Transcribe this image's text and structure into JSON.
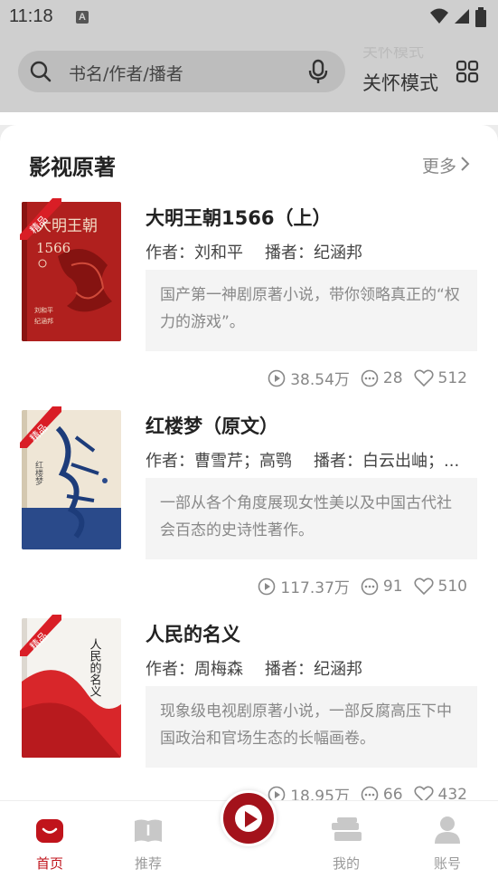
{
  "status_bar": {
    "time": "11:18",
    "a_label": "A"
  },
  "header": {
    "search_placeholder": "书名/作者/播者",
    "care_mode_ghost": "关怀模式",
    "care_mode_label": "关怀模式"
  },
  "section": {
    "title": "影视原著",
    "more_label": "更多"
  },
  "books": [
    {
      "badge": "精品",
      "cover_title": "大明王朝",
      "cover_subtitle": "1566",
      "cover_authors": [
        "刘和平",
        "纪涵邦"
      ],
      "title": "大明王朝1566（上）",
      "author_label": "作者：刘和平",
      "narrator_label": "播者：纪涵邦",
      "desc": "国产第一神剧原著小说，带你领略真正的“权力的游戏”。",
      "plays": "38.54万",
      "comments": "28",
      "likes": "512"
    },
    {
      "badge": "精品",
      "cover_title": "红楼梦",
      "title": "红楼梦（原文）",
      "author_label": "作者：曹雪芹；高鹗",
      "narrator_label": "播者：白云出岫；...",
      "desc": "一部从各个角度展现女性美以及中国古代社会百态的史诗性著作。",
      "plays": "117.37万",
      "comments": "91",
      "likes": "510"
    },
    {
      "badge": "精品",
      "cover_title": "人民的名义",
      "title": "人民的名义",
      "author_label": "作者：周梅森",
      "narrator_label": "播者：纪涵邦",
      "desc": "现象级电视剧原著小说，一部反腐高压下中国政治和官场生态的长幅画卷。",
      "plays": "18.95万",
      "comments": "66",
      "likes": "432"
    }
  ],
  "bottom_nav": {
    "items": [
      {
        "label": "首页",
        "icon": "home-icon",
        "active": true
      },
      {
        "label": "推荐",
        "icon": "book-open-icon",
        "active": false
      },
      {
        "label": "我的",
        "icon": "bookshelf-icon",
        "active": false
      },
      {
        "label": "账号",
        "icon": "user-icon",
        "active": false
      }
    ],
    "play_icon": "play-icon"
  },
  "colors": {
    "accent": "#c0141c",
    "play_button": "#a3121b",
    "header_bg": "#cfcfcf"
  }
}
